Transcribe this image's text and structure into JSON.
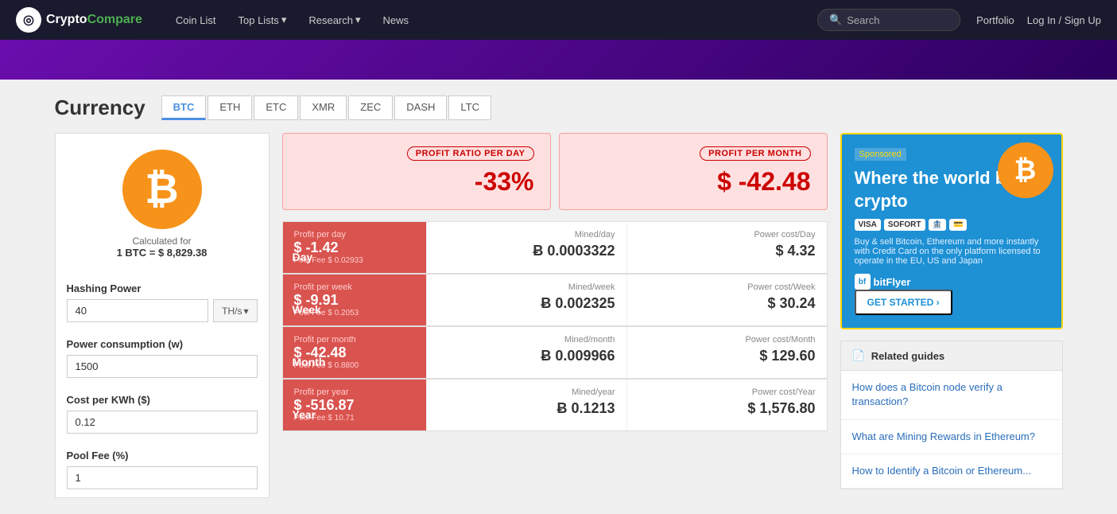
{
  "nav": {
    "logo_text_1": "Crypto",
    "logo_text_2": "Compare",
    "links": [
      {
        "id": "coin-list",
        "label": "Coin List",
        "has_dropdown": false
      },
      {
        "id": "top-lists",
        "label": "Top Lists",
        "has_dropdown": true
      },
      {
        "id": "research",
        "label": "Research",
        "has_dropdown": true
      },
      {
        "id": "news",
        "label": "News",
        "has_dropdown": false
      }
    ],
    "search_placeholder": "Search",
    "portfolio_label": "Portfolio",
    "auth_label": "Log In / Sign Up"
  },
  "currency": {
    "title": "Currency",
    "tabs": [
      "BTC",
      "ETH",
      "ETC",
      "XMR",
      "ZEC",
      "DASH",
      "LTC"
    ],
    "active_tab": "BTC"
  },
  "coin": {
    "symbol": "₿",
    "calc_label": "Calculated for",
    "calc_value": "1 BTC = $ 8,829.38"
  },
  "form": {
    "hashing_power_label": "Hashing Power",
    "hashing_power_value": "40",
    "hashing_power_unit": "TH/s",
    "power_consumption_label": "Power consumption (w)",
    "power_consumption_value": "1500",
    "cost_per_kwh_label": "Cost per KWh ($)",
    "cost_per_kwh_value": "0.12",
    "pool_fee_label": "Pool Fee (%)",
    "pool_fee_value": "1"
  },
  "profit_summary": {
    "ratio_label": "PROFIT RATIO PER DAY",
    "ratio_value": "-33%",
    "month_label": "PROFIT PER MONTH",
    "month_value": "$ -42.48"
  },
  "data_rows": [
    {
      "period": "Day",
      "profit_label": "Profit per day",
      "profit_value": "$ -1.42",
      "pool_fee": "Pool Fee $ 0.02933",
      "mined_label": "Mined/day",
      "mined_value": "Ƀ 0.0003322",
      "power_label": "Power cost/Day",
      "power_value": "$ 4.32"
    },
    {
      "period": "Week",
      "profit_label": "Profit per week",
      "profit_value": "$ -9.91",
      "pool_fee": "Pool Fee $ 0.2053",
      "mined_label": "Mined/week",
      "mined_value": "Ƀ 0.002325",
      "power_label": "Power cost/Week",
      "power_value": "$ 30.24"
    },
    {
      "period": "Month",
      "profit_label": "Profit per month",
      "profit_value": "$ -42.48",
      "pool_fee": "Pool Fee $ 0.8800",
      "mined_label": "Mined/month",
      "mined_value": "Ƀ 0.009966",
      "power_label": "Power cost/Month",
      "power_value": "$ 129.60"
    },
    {
      "period": "Year",
      "profit_label": "Profit per year",
      "profit_value": "$ -516.87",
      "pool_fee": "Pool Fee $ 10.71",
      "mined_label": "Mined/year",
      "mined_value": "Ƀ 0.1213",
      "power_label": "Power cost/Year",
      "power_value": "$ 1,576.80"
    }
  ],
  "ad": {
    "sponsored": "Sponsored",
    "title": "Where the world buys crypto",
    "payment_icons": [
      "VISA",
      "SOFORT",
      "🏦",
      "💳"
    ],
    "description": "Buy & sell Bitcoin, Ethereum and more instantly with Credit Card on the only platform licensed to operate in the EU, US and Japan",
    "cta": "GET STARTED ›",
    "logo": "bitFlyer"
  },
  "guides": {
    "header": "Related guides",
    "items": [
      "How does a Bitcoin node verify a transaction?",
      "What are Mining Rewards in Ethereum?",
      "How to Identify a Bitcoin or Ethereum..."
    ]
  }
}
